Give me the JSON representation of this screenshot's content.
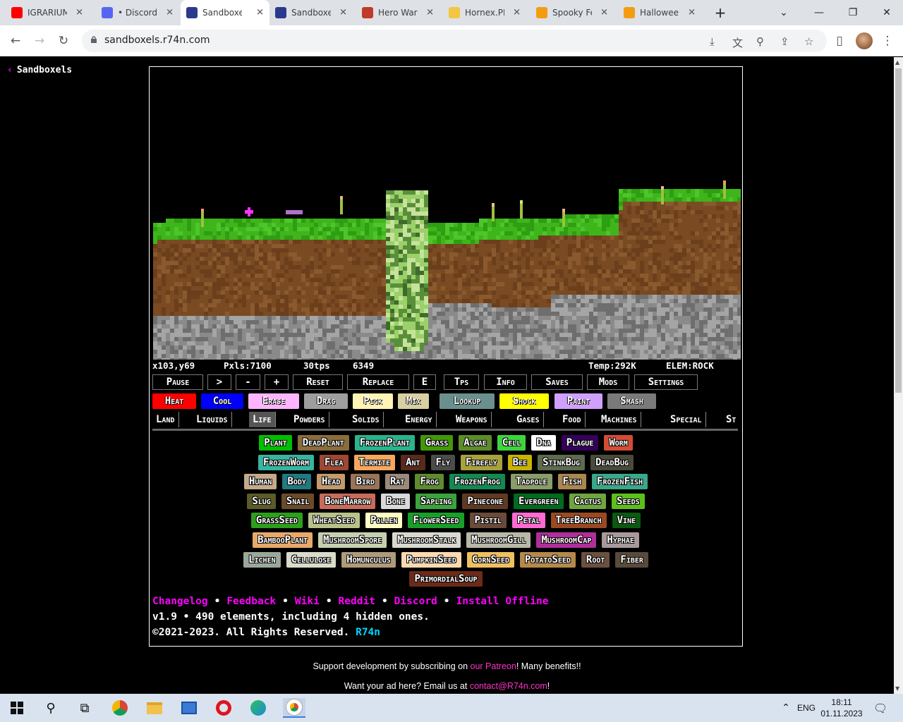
{
  "browser": {
    "tabs": [
      {
        "title": "IGRARIUM",
        "color": "#ff0000"
      },
      {
        "title": "• Discord",
        "color": "#5865f2"
      },
      {
        "title": "Sandboxels",
        "color": "#2b3a8c"
      },
      {
        "title": "Sandboxels",
        "color": "#2b3a8c"
      },
      {
        "title": "Hero Wars",
        "color": "#c0392b"
      },
      {
        "title": "Hornex.PRO",
        "color": "#f5c542"
      },
      {
        "title": "Spooky Fest",
        "color": "#f39c12"
      },
      {
        "title": "Halloween",
        "color": "#f39c12"
      }
    ],
    "new_tab": "+",
    "url": "sandboxels.r74n.com"
  },
  "page": {
    "back_label": "Sandboxels",
    "stats": {
      "coords": "x103,y69",
      "pixels": "Pxls:7100",
      "tps": "30tps",
      "tick": "6349",
      "temp": "Temp:292K",
      "elem": "ELEM:ROCK"
    },
    "controls": [
      "Pause",
      ">",
      "-",
      "+",
      "Reset",
      "Replace",
      "E",
      "Tps",
      "Info",
      "Saves",
      "Mods",
      "Settings"
    ],
    "tools": [
      {
        "label": "Heat",
        "color": "#ff0000"
      },
      {
        "label": "Cool",
        "color": "#0000ff"
      },
      {
        "label": "Erase",
        "color": "#fdb5ff"
      },
      {
        "label": "Drag",
        "color": "#9e9e9e"
      },
      {
        "label": "Pick",
        "color": "#fff4b5"
      },
      {
        "label": "Mix",
        "color": "#d8d0a0"
      },
      {
        "label": "Lookup",
        "color": "#6b8f8f"
      },
      {
        "label": "Shock",
        "color": "#ffff00"
      },
      {
        "label": "Paint",
        "color": "#d0a0ff"
      },
      {
        "label": "Smash",
        "color": "#7a7a7a"
      }
    ],
    "categories": [
      "Land",
      "Liquids",
      "Life",
      "Powders",
      "Solids",
      "Energy",
      "Weapons",
      "Gases",
      "Food",
      "Machines",
      "Special",
      "St"
    ],
    "selected_category": "Life",
    "element_rows": [
      [
        {
          "label": "Plant",
          "color": "#00bf00"
        },
        {
          "label": "DeadPlant",
          "color": "#8a6d3b"
        },
        {
          "label": "FrozenPlant",
          "color": "#2ab38c"
        },
        {
          "label": "Grass",
          "color": "#439809"
        },
        {
          "label": "Algae",
          "color": "#5d8c2a"
        },
        {
          "label": "Cell",
          "color": "#3fd43f"
        },
        {
          "label": "Dna",
          "color": "#ffffff"
        },
        {
          "label": "Plague",
          "color": "#36005c"
        },
        {
          "label": "Worm",
          "color": "#d34c37"
        }
      ],
      [
        {
          "label": "FrozenWorm",
          "color": "#37b5a0"
        },
        {
          "label": "Flea",
          "color": "#9e4732"
        },
        {
          "label": "Termite",
          "color": "#f5a85e"
        },
        {
          "label": "Ant",
          "color": "#5a2a1e"
        },
        {
          "label": "Fly",
          "color": "#4c4c4c"
        },
        {
          "label": "Firefly",
          "color": "#a8a23e"
        },
        {
          "label": "Bee",
          "color": "#c8b400"
        },
        {
          "label": "StinkBug",
          "color": "#5d6b4f"
        },
        {
          "label": "DeadBug",
          "color": "#4a4a3a"
        }
      ],
      [
        {
          "label": "Human",
          "color": "#c5a98a"
        },
        {
          "label": "Body",
          "color": "#1f7a82"
        },
        {
          "label": "Head",
          "color": "#c49a6b"
        },
        {
          "label": "Bird",
          "color": "#997457"
        },
        {
          "label": "Rat",
          "color": "#9b8a7a"
        },
        {
          "label": "Frog",
          "color": "#5f8a2f"
        },
        {
          "label": "FrozenFrog",
          "color": "#138a52"
        },
        {
          "label": "Tadpole",
          "color": "#8a9c6a"
        },
        {
          "label": "Fish",
          "color": "#ac8650"
        },
        {
          "label": "FrozenFish",
          "color": "#3aa88a"
        }
      ],
      [
        {
          "label": "Slug",
          "color": "#5c5b2a"
        },
        {
          "label": "Snail",
          "color": "#6b4a2a"
        },
        {
          "label": "BoneMarrow",
          "color": "#c86b5a"
        },
        {
          "label": "Bone",
          "color": "#d9d9d9"
        },
        {
          "label": "Sapling",
          "color": "#3ba33b"
        },
        {
          "label": "Pinecone",
          "color": "#5e3a22"
        },
        {
          "label": "Evergreen",
          "color": "#006b1f"
        },
        {
          "label": "Cactus",
          "color": "#6ea53f"
        },
        {
          "label": "Seeds",
          "color": "#5cc01a"
        }
      ],
      [
        {
          "label": "GrassSeed",
          "color": "#2e9e1d"
        },
        {
          "label": "WheatSeed",
          "color": "#b8c289"
        },
        {
          "label": "Pollen",
          "color": "#fffdc4"
        },
        {
          "label": "FlowerSeed",
          "color": "#1a9e2a"
        },
        {
          "label": "Pistil",
          "color": "#6b4a3a"
        },
        {
          "label": "Petal",
          "color": "#ff6bd3"
        },
        {
          "label": "TreeBranch",
          "color": "#9a4a22"
        },
        {
          "label": "Vine",
          "color": "#0a5a10"
        }
      ],
      [
        {
          "label": "BambooPlant",
          "color": "#e8a86a"
        },
        {
          "label": "MushroomSpore",
          "color": "#c5d0b0"
        },
        {
          "label": "MushroomStalk",
          "color": "#d8d8d0"
        },
        {
          "label": "MushroomGill",
          "color": "#b8b8a8"
        },
        {
          "label": "MushroomCap",
          "color": "#b02f9a"
        },
        {
          "label": "Hyphae",
          "color": "#a89a9a"
        }
      ],
      [
        {
          "label": "Lichen",
          "color": "#9aa89a"
        },
        {
          "label": "Cellulose",
          "color": "#d8dcc8"
        },
        {
          "label": "Homunculus",
          "color": "#b09a7a"
        },
        {
          "label": "PumpkinSeed",
          "color": "#ffd9b0"
        },
        {
          "label": "CornSeed",
          "color": "#f0c060"
        },
        {
          "label": "PotatoSeed",
          "color": "#b5894a"
        },
        {
          "label": "Root",
          "color": "#6b5040"
        },
        {
          "label": "Fiber",
          "color": "#5a4a3a"
        }
      ],
      [
        {
          "label": "PrimordialSoup",
          "color": "#6b2a1a"
        }
      ]
    ],
    "links": [
      "Changelog",
      "Feedback",
      "Wiki",
      "Reddit",
      "Discord",
      "Install Offline"
    ],
    "version": "v1.9 • 490 elements, including 4 hidden ones.",
    "copyright_prefix": "©2021-2023. All Rights Reserved.",
    "copyright_name": "R74n",
    "support_pre": "Support development by subscribing on ",
    "support_link": "our Patreon",
    "support_post": "! Many benefits!!",
    "ad_pre": "Want your ad here? Email us at ",
    "ad_link": "contact@R74n.com",
    "ad_post": "!"
  },
  "taskbar": {
    "lang": "ENG",
    "time": "18:11",
    "date": "01.11.2023"
  }
}
